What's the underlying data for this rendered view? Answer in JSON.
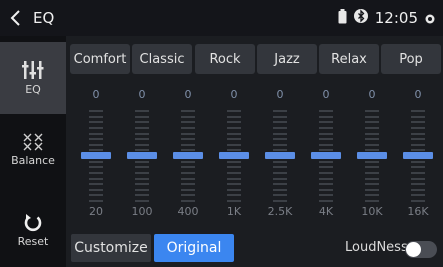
{
  "header": {
    "title": "EQ",
    "time": "12:05",
    "back_icon": "chevron-left-icon",
    "status_icons": [
      "battery-icon",
      "bluetooth-icon",
      "signal-dot-icon"
    ]
  },
  "sidebar": {
    "items": [
      {
        "label": "EQ",
        "icon": "equalizer-icon",
        "active": true
      },
      {
        "label": "Balance",
        "icon": "balance-icon",
        "active": false
      },
      {
        "label": "Reset",
        "icon": "reset-icon",
        "active": false
      }
    ]
  },
  "presets": [
    "Comfort",
    "Classic",
    "Rock",
    "Jazz",
    "Relax",
    "Pop"
  ],
  "bands": [
    {
      "freq": "20",
      "value": "0"
    },
    {
      "freq": "100",
      "value": "0"
    },
    {
      "freq": "400",
      "value": "0"
    },
    {
      "freq": "1K",
      "value": "0"
    },
    {
      "freq": "2.5K",
      "value": "0"
    },
    {
      "freq": "4K",
      "value": "0"
    },
    {
      "freq": "10K",
      "value": "0"
    },
    {
      "freq": "16K",
      "value": "0"
    }
  ],
  "footer": {
    "customize_label": "Customize",
    "original_label": "Original",
    "selected": "Original",
    "loudness_label": "LoudNess",
    "loudness_on": false
  },
  "colors": {
    "accent": "#3b86f0",
    "thumb": "#5b8ee6",
    "background": "#1b1d21"
  }
}
